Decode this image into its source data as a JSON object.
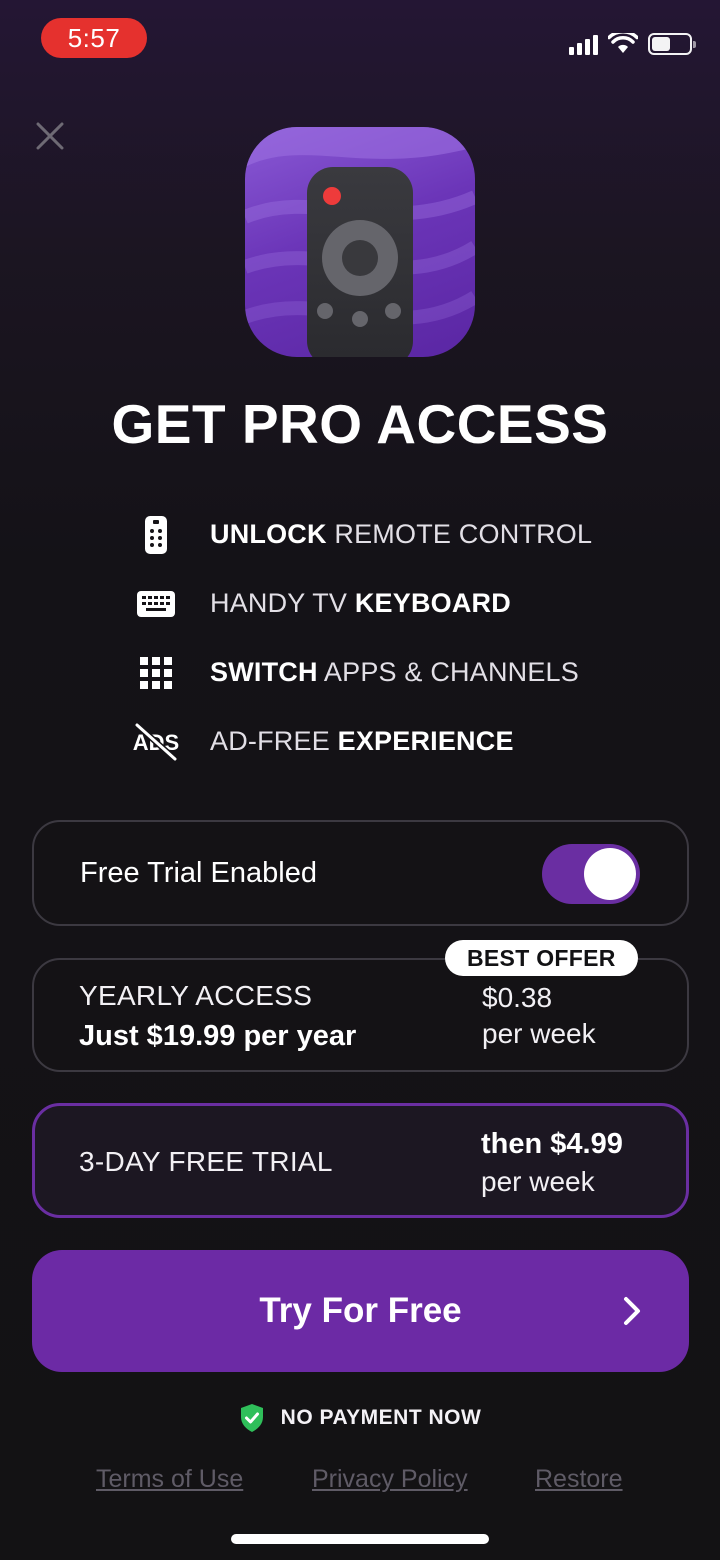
{
  "status_bar": {
    "time": "5:57",
    "battery_level": 0.5
  },
  "close_icon": "close-icon",
  "app_icon": "remote-control-app-icon",
  "title": "GET PRO ACCESS",
  "features": [
    {
      "icon": "remote-icon",
      "parts": [
        {
          "text": "UNLOCK",
          "bold": true
        },
        {
          "text": " REMOTE CONTROL",
          "bold": false
        }
      ]
    },
    {
      "icon": "keyboard-icon",
      "parts": [
        {
          "text": "HANDY TV ",
          "bold": false
        },
        {
          "text": "KEYBOARD",
          "bold": true
        }
      ]
    },
    {
      "icon": "grid-icon",
      "parts": [
        {
          "text": "SWITCH",
          "bold": true
        },
        {
          "text": " APPS & CHANNELS",
          "bold": false
        }
      ]
    },
    {
      "icon": "no-ads-icon",
      "parts": [
        {
          "text": "AD-FREE ",
          "bold": false
        },
        {
          "text": "EXPERIENCE",
          "bold": true
        }
      ]
    }
  ],
  "free_trial_toggle": {
    "label": "Free Trial Enabled",
    "enabled": true
  },
  "yearly_plan": {
    "badge": "BEST OFFER",
    "title": "YEARLY ACCESS",
    "subtitle": "Just $19.99 per year",
    "price": "$0.38",
    "period": "per week"
  },
  "trial_plan": {
    "title": "3-DAY FREE TRIAL",
    "price": "then $4.99",
    "period": "per week"
  },
  "cta": {
    "label": "Try For Free"
  },
  "no_payment": {
    "label": "NO PAYMENT NOW"
  },
  "links": {
    "terms": "Terms of Use",
    "privacy": "Privacy Policy",
    "restore": "Restore"
  },
  "colors": {
    "accent": "#6c2aa5",
    "shield": "#2fbf5a",
    "power": "#ee3b3b"
  }
}
